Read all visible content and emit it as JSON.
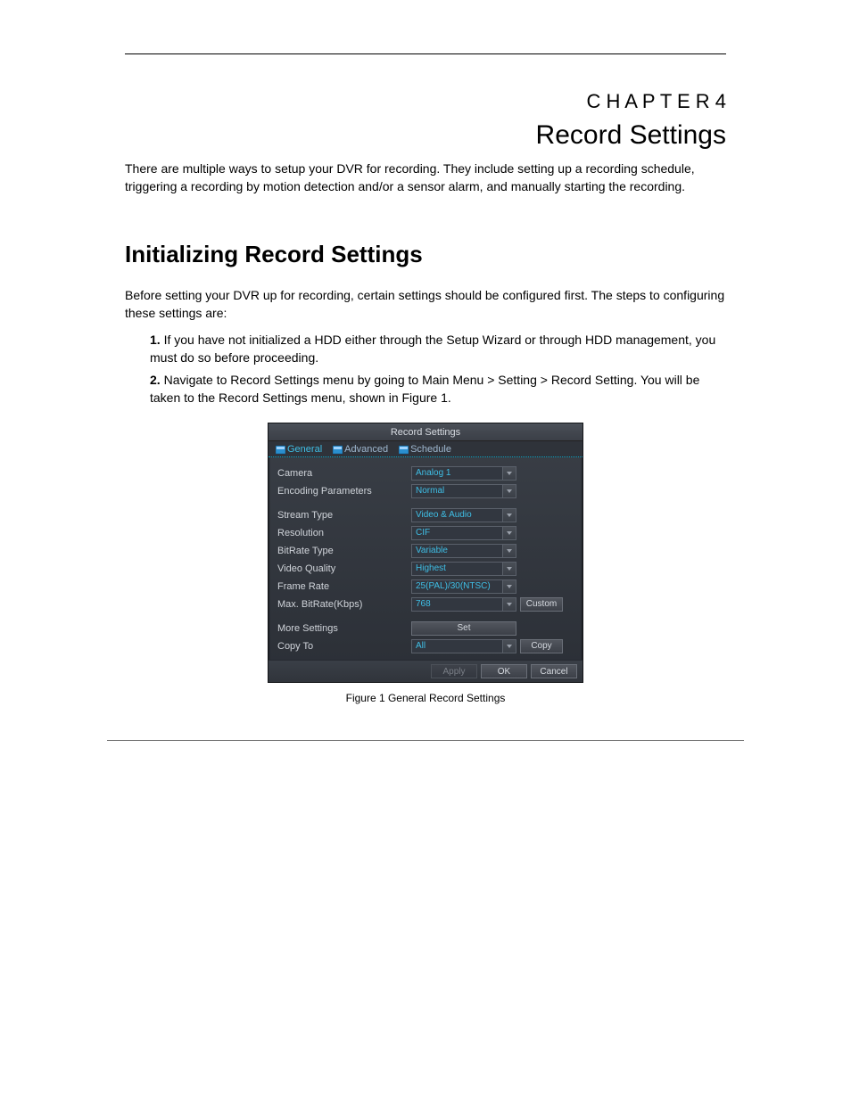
{
  "doc": {
    "chapter_label": "C H A P T E R 4",
    "chapter_title": "Record Settings",
    "section_title": "Initializing Record Settings",
    "intro": "There are multiple ways to setup your DVR for recording. They include setting up a recording schedule, triggering a recording by motion detection and/or a sensor alarm, and manually starting the recording.",
    "before": "Before setting your DVR up for recording, certain settings should be configured first. The steps to configuring these settings are:",
    "step1": "If you have not initialized a HDD either through the Setup Wizard or through HDD management, you must do so before proceeding.",
    "step2_a": "Navigate to Record Settings menu by going to Main Menu > Setting > Record Setting. You will be taken to the Record Settings menu, shown in ",
    "step2_b": "Figure 1",
    "step2_c": ".  ",
    "fig_caption": "Figure 1 General Record Settings"
  },
  "win": {
    "title": "Record Settings",
    "tabs": {
      "general": "General",
      "advanced": "Advanced",
      "schedule": "Schedule"
    },
    "labels": {
      "camera": "Camera",
      "encoding": "Encoding Parameters",
      "stream": "Stream Type",
      "resolution": "Resolution",
      "bitrate_type": "BitRate Type",
      "quality": "Video Quality",
      "frame_rate": "Frame Rate",
      "max_bitrate": "Max. BitRate(Kbps)",
      "more": "More Settings",
      "copy_to": "Copy To"
    },
    "values": {
      "camera": "Analog 1",
      "encoding": "Normal",
      "stream": "Video & Audio",
      "resolution": "CIF",
      "bitrate_type": "Variable",
      "quality": "Highest",
      "frame_rate": "25(PAL)/30(NTSC)",
      "max_bitrate": "768",
      "copy_to": "All"
    },
    "buttons": {
      "custom": "Custom",
      "set": "Set",
      "copy": "Copy",
      "apply": "Apply",
      "ok": "OK",
      "cancel": "Cancel"
    }
  }
}
